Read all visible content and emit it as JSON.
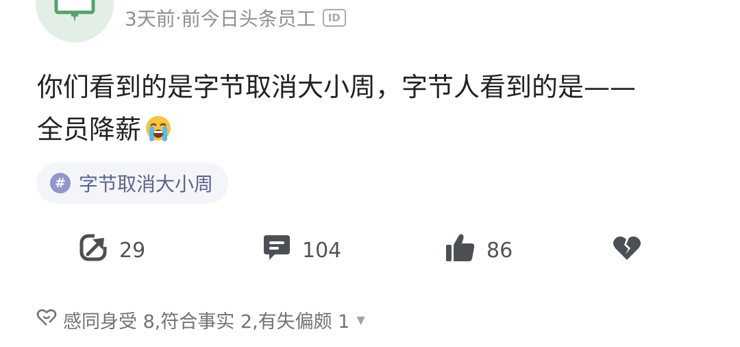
{
  "post": {
    "meta": {
      "time": "3天前",
      "separator": "·",
      "author_title": "前今日头条员工",
      "id_badge": "ID"
    },
    "text_line1": "你们看到的是字节取消大小周，字节人看到的是——",
    "text_line2": "全员降薪",
    "emoji": "loudly-crying-face",
    "tag": {
      "label": "字节取消大小周"
    }
  },
  "actions": {
    "share_count": "29",
    "comment_count": "104",
    "like_count": "86"
  },
  "reactions": {
    "summary": "感同身受 8,符合事实 2,有失偏颇 1"
  },
  "colors": {
    "icon_dark": "#4c4f53",
    "meta_gray": "#8d9096",
    "tag_bg": "#f4f5f9",
    "tag_icon": "#8f98c8",
    "avatar_bg": "#e3efe6",
    "avatar_fg": "#56a26c"
  }
}
